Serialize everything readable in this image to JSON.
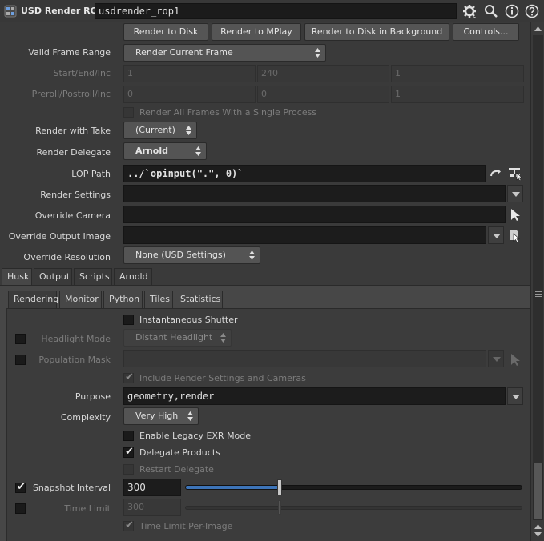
{
  "header": {
    "node_type": "USD Render ROP",
    "node_name": "usdrender_rop1"
  },
  "buttons": {
    "render_to_disk": "Render to Disk",
    "render_to_mplay": "Render to MPlay",
    "render_bg": "Render to Disk in Background",
    "controls": "Controls..."
  },
  "params": {
    "valid_frame_range": {
      "label": "Valid Frame Range",
      "value": "Render Current Frame"
    },
    "start_end_inc": {
      "label": "Start/End/Inc",
      "values": [
        "1",
        "240",
        "1"
      ]
    },
    "preroll": {
      "label": "Preroll/Postroll/Inc",
      "values": [
        "0",
        "0",
        "1"
      ]
    },
    "render_all_frames": {
      "label": "Render All Frames With a Single Process"
    },
    "render_with_take": {
      "label": "Render with Take",
      "value": "(Current)"
    },
    "render_delegate": {
      "label": "Render Delegate",
      "value": "Arnold"
    },
    "lop_path": {
      "label": "LOP Path",
      "value": "../`opinput(\".\", 0)`"
    },
    "render_settings": {
      "label": "Render Settings",
      "value": ""
    },
    "override_camera": {
      "label": "Override Camera",
      "value": ""
    },
    "override_output_image": {
      "label": "Override Output Image",
      "value": ""
    },
    "override_resolution": {
      "label": "Override Resolution",
      "value": "None (USD Settings)"
    }
  },
  "tabs_main": [
    "Husk",
    "Output",
    "Scripts",
    "Arnold"
  ],
  "tabs_sub": [
    "Rendering",
    "Monitor",
    "Python",
    "Tiles",
    "Statistics"
  ],
  "rendering": {
    "instantaneous_shutter": "Instantaneous Shutter",
    "headlight_mode": {
      "label": "Headlight Mode",
      "value": "Distant Headlight"
    },
    "population_mask": {
      "label": "Population Mask",
      "value": ""
    },
    "include_render_settings": "Include Render Settings and Cameras",
    "purpose": {
      "label": "Purpose",
      "value": "geometry,render"
    },
    "complexity": {
      "label": "Complexity",
      "value": "Very High"
    },
    "legacy_exr": "Enable Legacy EXR Mode",
    "delegate_products": "Delegate Products",
    "restart_delegate": "Restart Delegate",
    "snapshot_interval": {
      "label": "Snapshot Interval",
      "value": "300",
      "slider_fraction": 0.28
    },
    "time_limit": {
      "label": "Time Limit",
      "value": "300",
      "slider_fraction": 0.28
    },
    "time_limit_per_image": "Time Limit Per-Image"
  },
  "colors": {
    "background": "#3a3a3a",
    "field": "#1c1c1c",
    "slider_fill": "#3d74b8",
    "node_icon": "#5a8fd0"
  },
  "icons": [
    "usd-render-node-icon",
    "gear-icon",
    "search-icon",
    "info-icon",
    "help-icon",
    "pin-arrow-icon",
    "node-chooser-icon",
    "camera-pointer-icon",
    "file-chooser-icon"
  ]
}
